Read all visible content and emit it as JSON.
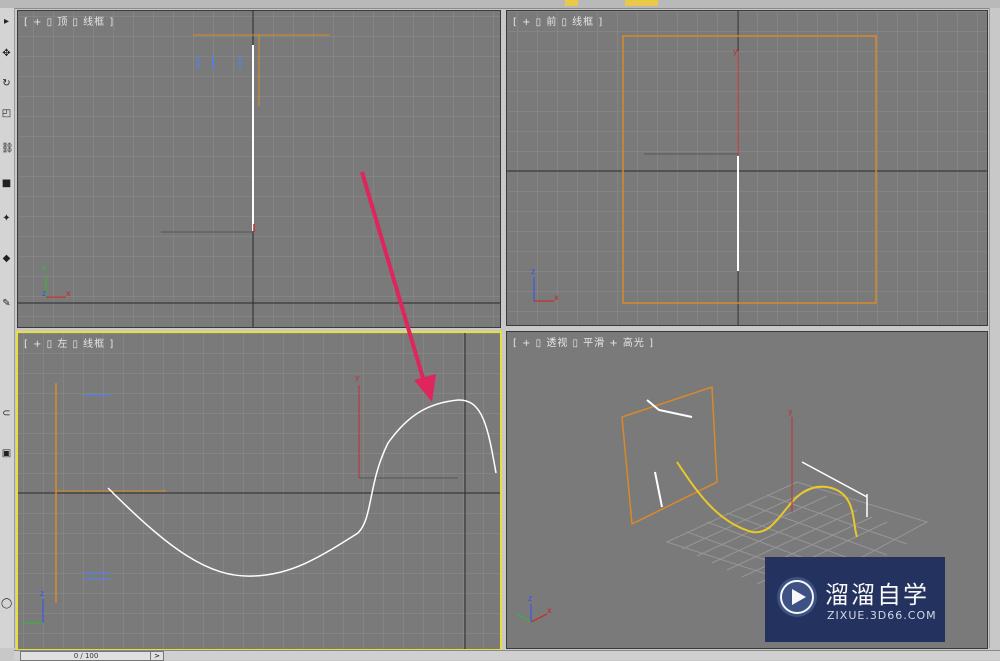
{
  "viewports": {
    "top": {
      "label": "[ + ▯ 顶 ▯ 线框 ]"
    },
    "front": {
      "label": "[ + ▯ 前 ▯ 线框 ]"
    },
    "left": {
      "label": "[ + ▯ 左 ▯ 线框 ]"
    },
    "perspective": {
      "label": "[ + ▯ 透视 ▯ 平滑 + 高光 ]"
    }
  },
  "axes": {
    "x": "x",
    "y": "y",
    "z": "z"
  },
  "timeline": {
    "frame": "0 / 100",
    "next": ">"
  },
  "watermark": {
    "title": "溜溜自学",
    "url": "ZIXUE.3D66.COM"
  },
  "colors": {
    "active_border": "#e9df3b",
    "arrow": "#e0245e",
    "object": "#d88a2a"
  },
  "toolbar_icons": [
    "select-icon",
    "move-icon",
    "rotate-icon",
    "scale-icon",
    "link-icon",
    "camera-icon",
    "light-icon",
    "shape-icon",
    "paint-icon",
    "magnet-icon",
    "display-icon"
  ]
}
